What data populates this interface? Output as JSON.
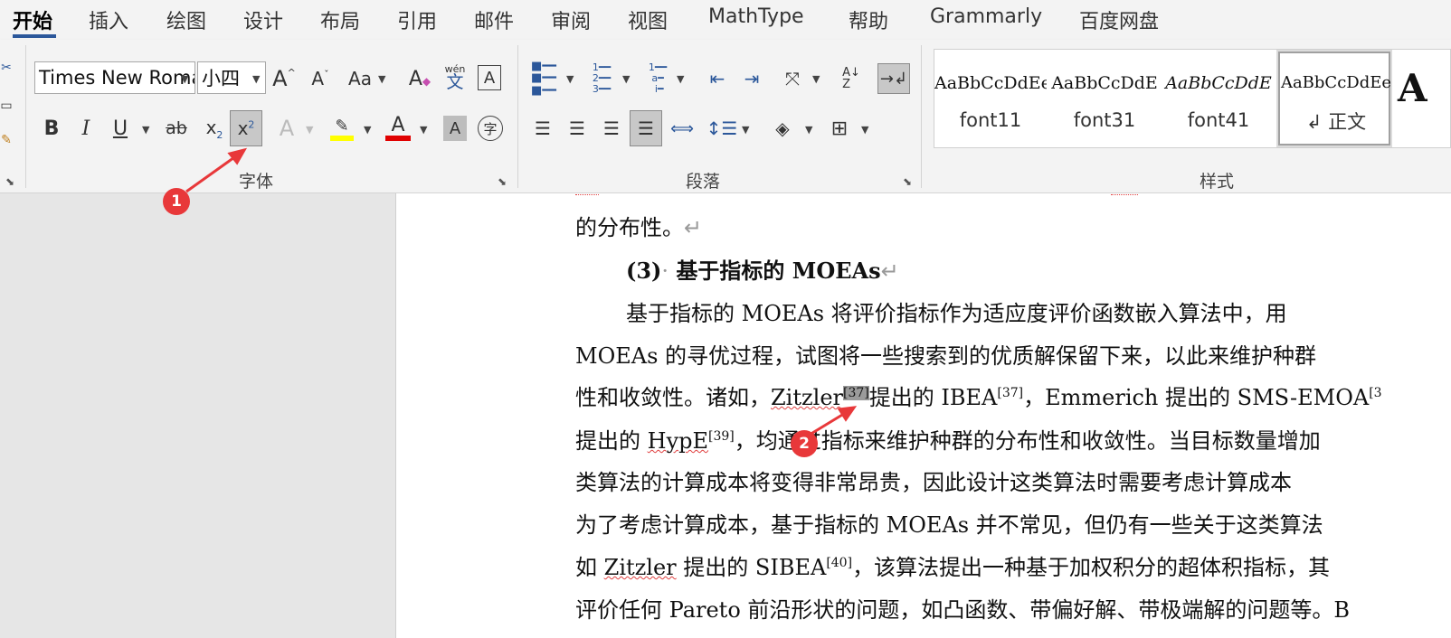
{
  "tabs": [
    "开始",
    "插入",
    "绘图",
    "设计",
    "布局",
    "引用",
    "邮件",
    "审阅",
    "视图",
    "MathType",
    "帮助",
    "Grammarly",
    "百度网盘"
  ],
  "font": {
    "family_value": "Times New Roman",
    "size_value": "小四",
    "grow_label": "A",
    "shrink_label": "A",
    "case_label": "Aa",
    "pinyin_top": "wén",
    "pinyin_bottom": "文",
    "border_char": "A",
    "bold": "B",
    "italic": "I",
    "underline": "U",
    "strike": "ab",
    "subscript_base": "x",
    "subscript_mark": "2",
    "superscript_base": "x",
    "superscript_mark": "2",
    "effects": "A",
    "font_color": "A",
    "shading": "A",
    "enclose": "字",
    "group_label": "字体"
  },
  "paragraph": {
    "group_label": "段落"
  },
  "styles": {
    "group_label": "样式",
    "items": [
      {
        "preview": "AaBbCcDdEe",
        "name": "font11"
      },
      {
        "preview": "AaBbCcDdE",
        "name": "font31"
      },
      {
        "preview": "AaBbCcDdE",
        "name": "font41"
      },
      {
        "preview": "AaBbCcDdEe",
        "name": "↲ 正文"
      }
    ],
    "big_preview": "A"
  },
  "colors": {
    "highlight": "#ffff00",
    "font_color": "#e00000",
    "tab_underline": "#2b579a",
    "badge": "#e8383a"
  },
  "annotations": [
    "1",
    "2"
  ],
  "document": {
    "l1": "的分布性。",
    "heading_num": "(3)",
    "heading_text": "基于指标的 MOEAs",
    "l3": "基于指标的  MOEAs  将评价指标作为适应度评价函数嵌入算法中，用",
    "l4": "MOEAs 的寻优过程，试图将一些搜索到的优质解保留下来，以此来维护种群",
    "l5a": "性和收敛性。诸如，",
    "l5_zitzler": "Zitzler",
    "l5_ref1": "[37]",
    "l5b": "提出的 IBEA",
    "l5_ref2": "[37]",
    "l5c": "，Emmerich 提出的 SMS-EMOA",
    "l5_ref3": "[3",
    "l6a": "提出的 ",
    "l6_hype": "HypE",
    "l6_ref": "[39]",
    "l6b": "，均通过指标来维护种群的分布性和收敛性。当目标数量增加",
    "l7": "类算法的计算成本将变得非常昂贵，因此设计这类算法时需要考虑计算成本",
    "l8": "为了考虑计算成本，基于指标的 MOEAs 并不常见，但仍有一些关于这类算法",
    "l9a": "如 ",
    "l9_zitzler": "Zitzler",
    "l9b": " 提出的 SIBEA",
    "l9_ref": "[40]",
    "l9c": "，该算法提出一种基于加权积分的超体积指标，其",
    "l10": "评价任何 Pareto 前沿形状的问题，如凸函数、带偏好解、带极端解的问题等。B"
  }
}
